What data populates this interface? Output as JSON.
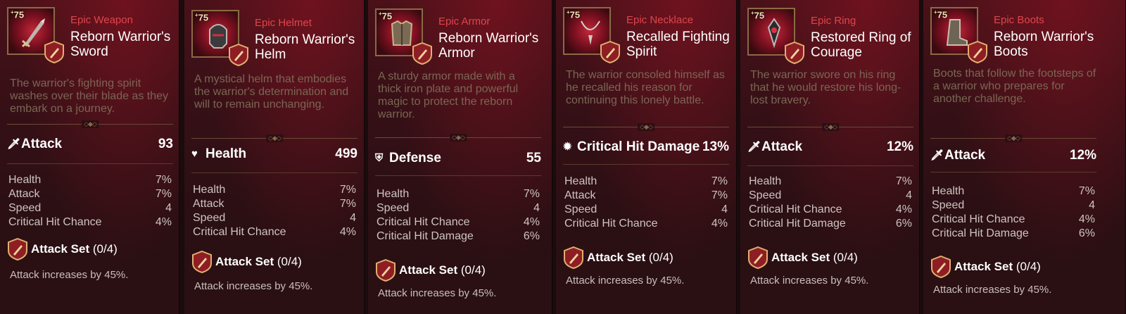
{
  "cards": [
    {
      "level": "75",
      "rarity": "Epic Weapon",
      "name": "Reborn Warrior's Sword",
      "item_icon": "sword-icon",
      "description": "The warrior's fighting spirit washes over their blade as they embark on a journey.",
      "main_stat": {
        "icon": "attack-icon",
        "label": "Attack",
        "value": "93"
      },
      "substats": [
        {
          "label": "Health",
          "value": "7%"
        },
        {
          "label": "Attack",
          "value": "7%"
        },
        {
          "label": "Speed",
          "value": "4"
        },
        {
          "label": "Critical Hit Chance",
          "value": "4%"
        }
      ],
      "set_name": "Attack Set",
      "set_count": "(0/4)",
      "set_desc": "Attack increases by 45%."
    },
    {
      "level": "75",
      "rarity": "Epic Helmet",
      "name": "Reborn Warrior's Helm",
      "item_icon": "helmet-icon",
      "description": "A mystical helm that embodies the warrior's determination and will to remain unchanging.",
      "main_stat": {
        "icon": "health-icon",
        "label": "Health",
        "value": "499"
      },
      "substats": [
        {
          "label": "Health",
          "value": "7%"
        },
        {
          "label": "Attack",
          "value": "7%"
        },
        {
          "label": "Speed",
          "value": "4"
        },
        {
          "label": "Critical Hit Chance",
          "value": "4%"
        }
      ],
      "set_name": "Attack Set",
      "set_count": "(0/4)",
      "set_desc": "Attack increases by 45%."
    },
    {
      "level": "75",
      "rarity": "Epic Armor",
      "name": "Reborn Warrior's Armor",
      "item_icon": "armor-icon",
      "description": "A sturdy armor made with a thick iron plate and powerful magic to protect the reborn warrior.",
      "main_stat": {
        "icon": "defense-icon",
        "label": "Defense",
        "value": "55"
      },
      "substats": [
        {
          "label": "Health",
          "value": "7%"
        },
        {
          "label": "Speed",
          "value": "4"
        },
        {
          "label": "Critical Hit Chance",
          "value": "4%"
        },
        {
          "label": "Critical Hit Damage",
          "value": "6%"
        }
      ],
      "set_name": "Attack Set",
      "set_count": "(0/4)",
      "set_desc": "Attack increases by 45%."
    },
    {
      "level": "75",
      "rarity": "Epic Necklace",
      "name": "Recalled Fighting Spirit",
      "item_icon": "necklace-icon",
      "description": "The warrior consoled himself as he recalled his reason for continuing this lonely battle.",
      "main_stat": {
        "icon": "crit-damage-icon",
        "label": "Critical Hit Damage",
        "value": "13%"
      },
      "substats": [
        {
          "label": "Health",
          "value": "7%"
        },
        {
          "label": "Attack",
          "value": "7%"
        },
        {
          "label": "Speed",
          "value": "4"
        },
        {
          "label": "Critical Hit Chance",
          "value": "4%"
        }
      ],
      "set_name": "Attack Set",
      "set_count": "(0/4)",
      "set_desc": "Attack increases by 45%."
    },
    {
      "level": "75",
      "rarity": "Epic Ring",
      "name": "Restored Ring of Courage",
      "item_icon": "ring-icon",
      "description": "The warrior swore on his ring that he would restore his long-lost bravery.",
      "main_stat": {
        "icon": "attack-icon",
        "label": "Attack",
        "value": "12%"
      },
      "substats": [
        {
          "label": "Health",
          "value": "7%"
        },
        {
          "label": "Speed",
          "value": "4"
        },
        {
          "label": "Critical Hit Chance",
          "value": "4%"
        },
        {
          "label": "Critical Hit Damage",
          "value": "6%"
        }
      ],
      "set_name": "Attack Set",
      "set_count": "(0/4)",
      "set_desc": "Attack increases by 45%."
    },
    {
      "level": "75",
      "rarity": "Epic Boots",
      "name": "Reborn Warrior's Boots",
      "item_icon": "boots-icon",
      "description": "Boots that follow the footsteps of a warrior who prepares for another challenge.",
      "main_stat": {
        "icon": "attack-icon",
        "label": "Attack",
        "value": "12%"
      },
      "substats": [
        {
          "label": "Health",
          "value": "7%"
        },
        {
          "label": "Speed",
          "value": "4"
        },
        {
          "label": "Critical Hit Chance",
          "value": "4%"
        },
        {
          "label": "Critical Hit Damage",
          "value": "6%"
        }
      ],
      "set_name": "Attack Set",
      "set_count": "(0/4)",
      "set_desc": "Attack increases by 45%."
    }
  ],
  "colors": {
    "rarity": "#e0444b",
    "frame_gold": "#8a6a46",
    "desc_text": "#7b6654"
  }
}
